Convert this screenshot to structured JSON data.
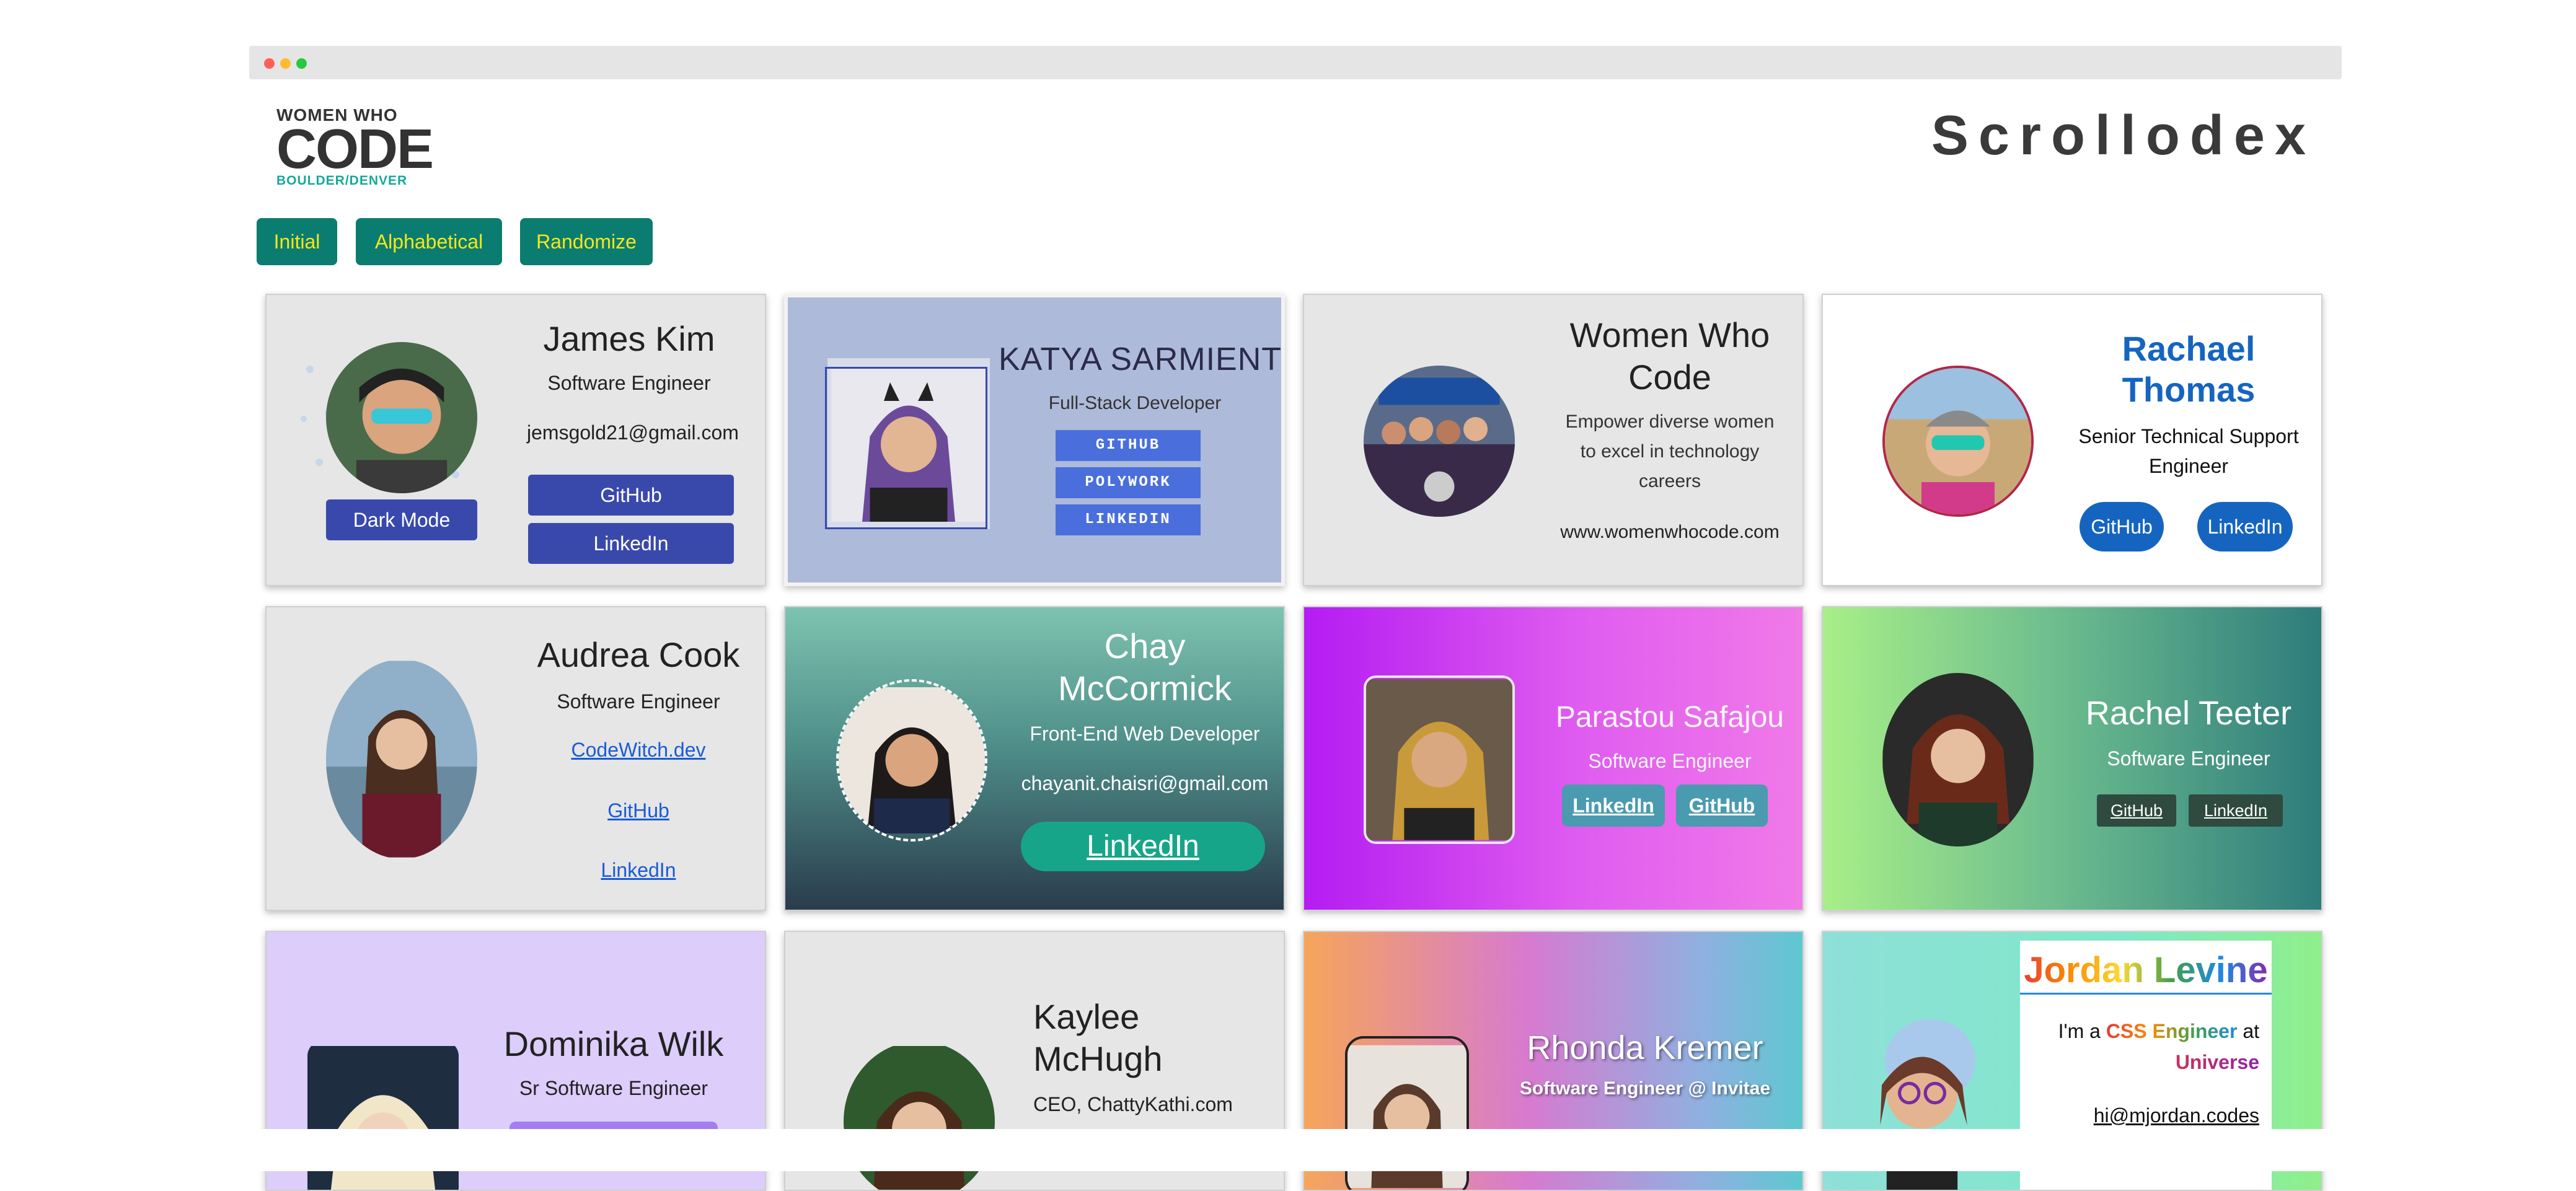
{
  "header": {
    "logo": {
      "line1": "WOMEN WHO",
      "line2": "CODE",
      "line3": "BOULDER/DENVER"
    },
    "title": "Scrollodex"
  },
  "controls": {
    "initial": "Initial",
    "alphabetical": "Alphabetical",
    "randomize": "Randomize"
  },
  "cards": {
    "james": {
      "name": "James Kim",
      "role": "Software Engineer",
      "email": "jemsgold21@gmail.com",
      "dark_mode": "Dark Mode",
      "github": "GitHub",
      "linkedin": "LinkedIn"
    },
    "katya": {
      "name": "KATYA SARMIENTO",
      "role": "Full-Stack Developer",
      "github": "GITHUB",
      "polywork": "POLYWORK",
      "linkedin": "LINKEDIN"
    },
    "wwc": {
      "name_line1": "Women Who",
      "name_line2": "Code",
      "desc_line1": "Empower diverse women",
      "desc_line2": "to excel in technology",
      "desc_line3": "careers",
      "url": "www.womenwhocode.com"
    },
    "rachael": {
      "name_line1": "Rachael",
      "name_line2": "Thomas",
      "role_line1": "Senior Technical Support",
      "role_line2": "Engineer",
      "github": "GitHub",
      "linkedin": "LinkedIn"
    },
    "audrea": {
      "name": "Audrea Cook",
      "role": "Software Engineer",
      "site": "CodeWitch.dev",
      "github": "GitHub",
      "linkedin": "LinkedIn"
    },
    "chay": {
      "name_line1": "Chay",
      "name_line2": "McCormick",
      "role": "Front-End Web Developer",
      "email": "chayanit.chaisri@gmail.com",
      "linkedin": "LinkedIn"
    },
    "parastou": {
      "name": "Parastou Safajou",
      "role": "Software Engineer",
      "linkedin": "LinkedIn",
      "github": "GitHub"
    },
    "rachel": {
      "name": "Rachel Teeter",
      "role": "Software Engineer",
      "github": "GitHub",
      "linkedin": "LinkedIn"
    },
    "dominika": {
      "name": "Dominika Wilk",
      "role": "Sr Software Engineer"
    },
    "kaylee": {
      "name_line1": "Kaylee",
      "name_line2": "McHugh",
      "role": "CEO, ChattyKathi.com"
    },
    "rhonda": {
      "name": "Rhonda Kremer",
      "role": "Software Engineer @ Invitae"
    },
    "jordan": {
      "name": "Jordan Levine",
      "intro_a": "I'm a",
      "intro_css": "CSS Engineer",
      "intro_b": "at",
      "intro_universe": "Universe",
      "email": "hi@mjordan.codes"
    }
  },
  "colors": {
    "button_bg": "#0b7c70",
    "button_text": "#f4e81a",
    "accent_blue": "#3949ab",
    "rachael_blue": "#1565c0"
  }
}
